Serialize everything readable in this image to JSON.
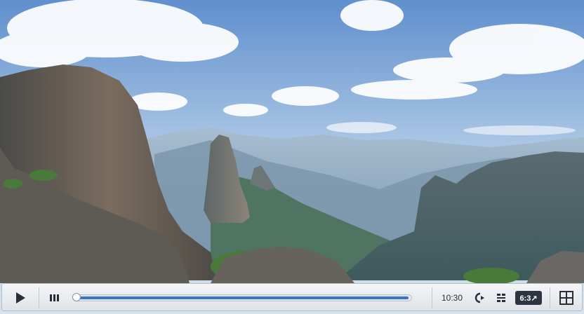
{
  "video": {
    "frame_alt": "",
    "sky_color": "#7fa8d6"
  },
  "player": {
    "play_icon": "play-icon",
    "volume_icon": "volume-icon",
    "progress": 0.0,
    "current_time": "10:30",
    "cc_icon": "closed-captions-icon",
    "settings_icon": "settings-icon",
    "speed_label": "6:3↗",
    "fullscreen_icon": "fullscreen-icon",
    "accent_color": "#3a74c8"
  }
}
